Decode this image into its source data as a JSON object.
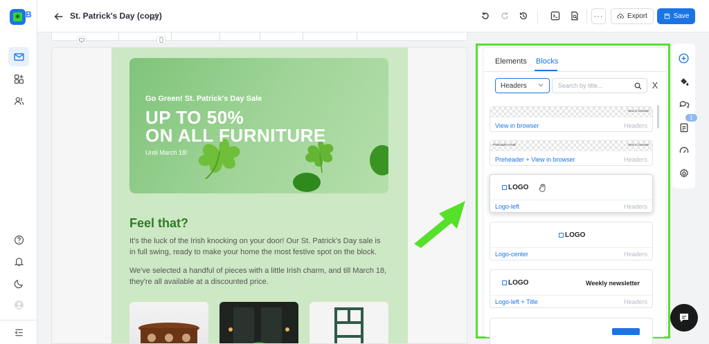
{
  "app": {
    "logo_clip": "B"
  },
  "topbar": {
    "title": "St. Patrick's Day (copy)",
    "more_label": "···",
    "export_label": "Export",
    "save_label": "Save"
  },
  "email": {
    "hero": {
      "kicker": "Go Green! St. Patrick's Day Sale",
      "headline_1": "UP TO 50%",
      "headline_2": "ON ALL FURNITURE",
      "until": "Until March 18!"
    },
    "heading": "Feel that?",
    "paragraph_1": "It's the luck of the Irish knocking on your door! Our St. Patrick's Day sale is in full swing, ready to make your home the most festive spot on the block.",
    "paragraph_2": "We've selected a handful of pieces with a little Irish charm, and till March 18, they're all available at a discounted price."
  },
  "panel": {
    "tabs": [
      {
        "label": "Elements"
      },
      {
        "label": "Blocks"
      }
    ],
    "category_select": "Headers",
    "search_placeholder": "Search by title...",
    "clear_label": "X",
    "cards": [
      {
        "name": "View in browser",
        "category": "Headers",
        "preview_right": "View in browser"
      },
      {
        "name": "Preheader + View in browser",
        "category": "Headers",
        "preview_left": "Preheader email",
        "preview_right": "View in browser"
      },
      {
        "name": "Logo-left",
        "category": "Headers",
        "logo": "LOGO"
      },
      {
        "name": "Logo-center",
        "category": "Headers",
        "logo": "LOGO"
      },
      {
        "name": "Logo-left + Title",
        "category": "Headers",
        "logo": "LOGO",
        "title": "Weekly newsletter"
      }
    ]
  },
  "right_rail": {
    "badge_count": "1"
  },
  "colors": {
    "accent": "#1b74e4",
    "highlight": "#55e02a",
    "email_bg": "#cde8c4",
    "heading_green": "#2f7a24"
  }
}
